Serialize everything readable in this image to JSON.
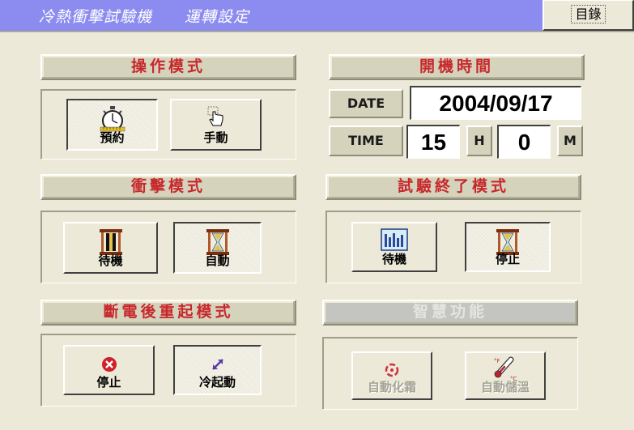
{
  "header": {
    "title": "冷熱衝擊試驗機　　運轉設定",
    "record_button": "目錄"
  },
  "operation_mode": {
    "title": "操作模式",
    "buttons": [
      {
        "label": "預約",
        "icon": "stopwatch-icon",
        "pressed": true
      },
      {
        "label": "手動",
        "icon": "hand-pointer-icon",
        "pressed": false
      }
    ]
  },
  "start_time": {
    "title": "開機時間",
    "date_label": "DATE",
    "date_value": "2004/09/17",
    "time_label": "TIME",
    "hour_value": "15",
    "hour_unit": "H",
    "minute_value": "0",
    "minute_unit": "M"
  },
  "shock_mode": {
    "title": "衝擊模式",
    "buttons": [
      {
        "label": "待機",
        "icon": "standby-hourglass-icon",
        "pressed": false
      },
      {
        "label": "自動",
        "icon": "hourglass-icon",
        "pressed": true
      }
    ]
  },
  "test_end_mode": {
    "title": "試驗終了模式",
    "buttons": [
      {
        "label": "待機",
        "icon": "bar-graph-icon",
        "pressed": false
      },
      {
        "label": "停止",
        "icon": "hourglass-icon",
        "pressed": true
      }
    ]
  },
  "power_recovery_mode": {
    "title": "斷電後重起模式",
    "buttons": [
      {
        "label": "停止",
        "icon": "stop-circle-icon",
        "pressed": false
      },
      {
        "label": "冷起動",
        "icon": "arrows-icon",
        "pressed": true
      }
    ]
  },
  "smart_functions": {
    "title": "智慧功能",
    "enabled": false,
    "buttons": [
      {
        "label": "自動化霜",
        "icon": "defrost-icon",
        "enabled": false
      },
      {
        "label": "自動儲溫",
        "icon": "thermometer-icon",
        "enabled": false
      }
    ]
  },
  "colors": {
    "header_bg": "#8c8cf0",
    "title_red": "#c8282c",
    "panel_bg": "#ece9d8"
  }
}
